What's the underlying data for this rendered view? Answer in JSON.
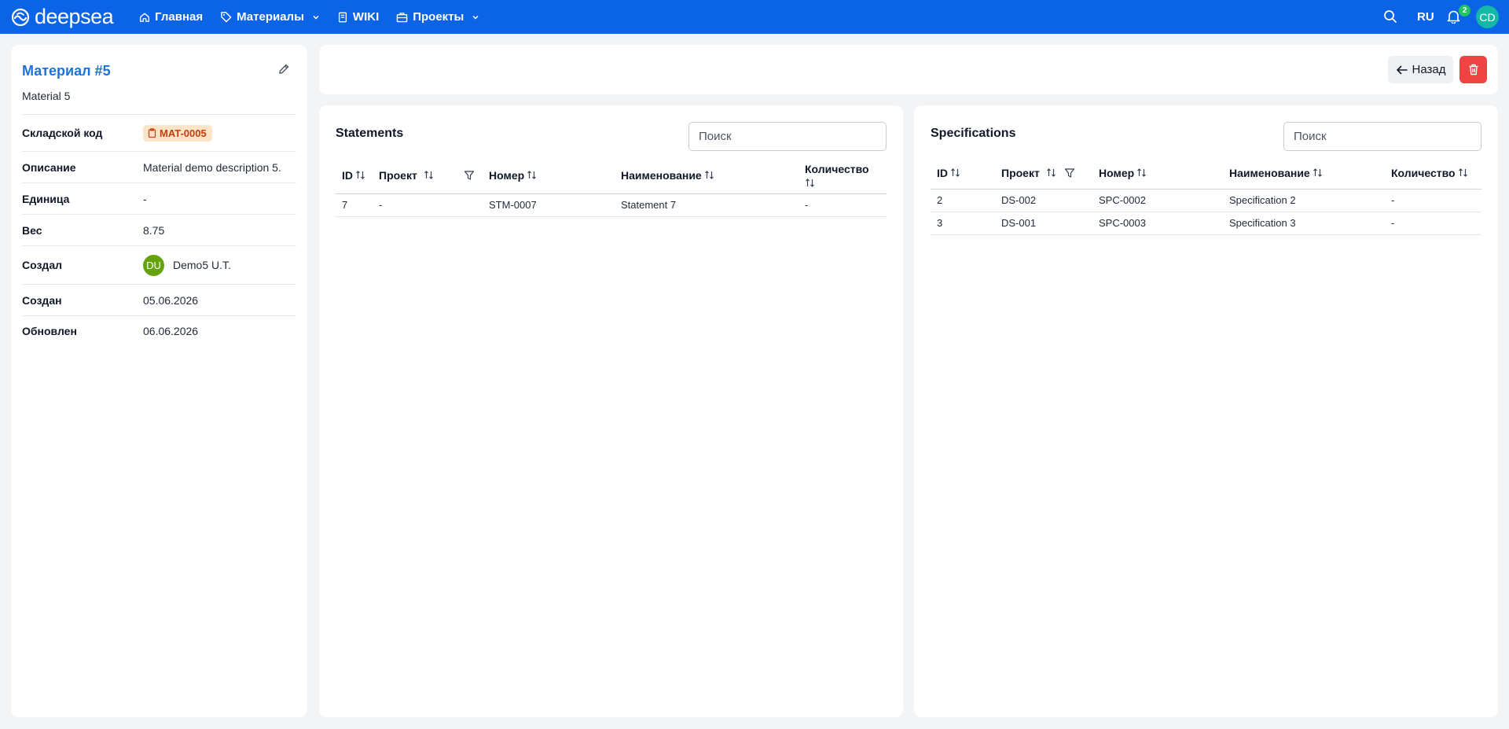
{
  "header": {
    "brand": "deepsea",
    "nav": [
      {
        "label": "Главная",
        "icon": "home-icon"
      },
      {
        "label": "Материалы",
        "icon": "tag-icon",
        "dropdown": true
      },
      {
        "label": "WIKI",
        "icon": "book-icon"
      },
      {
        "label": "Проекты",
        "icon": "briefcase-icon",
        "dropdown": true
      }
    ],
    "lang": "RU",
    "notifications_count": "2",
    "avatar_initials": "CD"
  },
  "material": {
    "title": "Материал #5",
    "subtitle": "Material 5",
    "props": [
      {
        "label": "Складской код",
        "value": "MAT-0005"
      },
      {
        "label": "Описание",
        "value": "Material demo description 5."
      },
      {
        "label": "Единица",
        "value": "-"
      },
      {
        "label": "Вес",
        "value": "8.75"
      },
      {
        "label": "Создал",
        "value": "Demo5 U.T.",
        "avatar": "DU"
      },
      {
        "label": "Создан",
        "value": "05.06.2026"
      },
      {
        "label": "Обновлен",
        "value": "06.06.2026"
      }
    ]
  },
  "actions": {
    "back_label": "Назад"
  },
  "statements": {
    "title": "Statements",
    "search_placeholder": "Поиск",
    "columns": [
      "ID",
      "Проект",
      "Номер",
      "Наименование",
      "Количество"
    ],
    "rows": [
      [
        "7",
        "-",
        "STM-0007",
        "Statement 7",
        "-"
      ]
    ]
  },
  "specifications": {
    "title": "Specifications",
    "search_placeholder": "Поиск",
    "columns": [
      "ID",
      "Проект",
      "Номер",
      "Наименование",
      "Количество"
    ],
    "rows": [
      [
        "2",
        "DS-002",
        "SPC-0002",
        "Specification 2",
        "-"
      ],
      [
        "3",
        "DS-001",
        "SPC-0003",
        "Specification 3",
        "-"
      ]
    ]
  },
  "colors": {
    "header_bg": "#0b63e5",
    "accent": "#1d72d8",
    "danger": "#ef4444",
    "badge_bg": "#fde3c8",
    "badge_text": "#c2410c"
  }
}
